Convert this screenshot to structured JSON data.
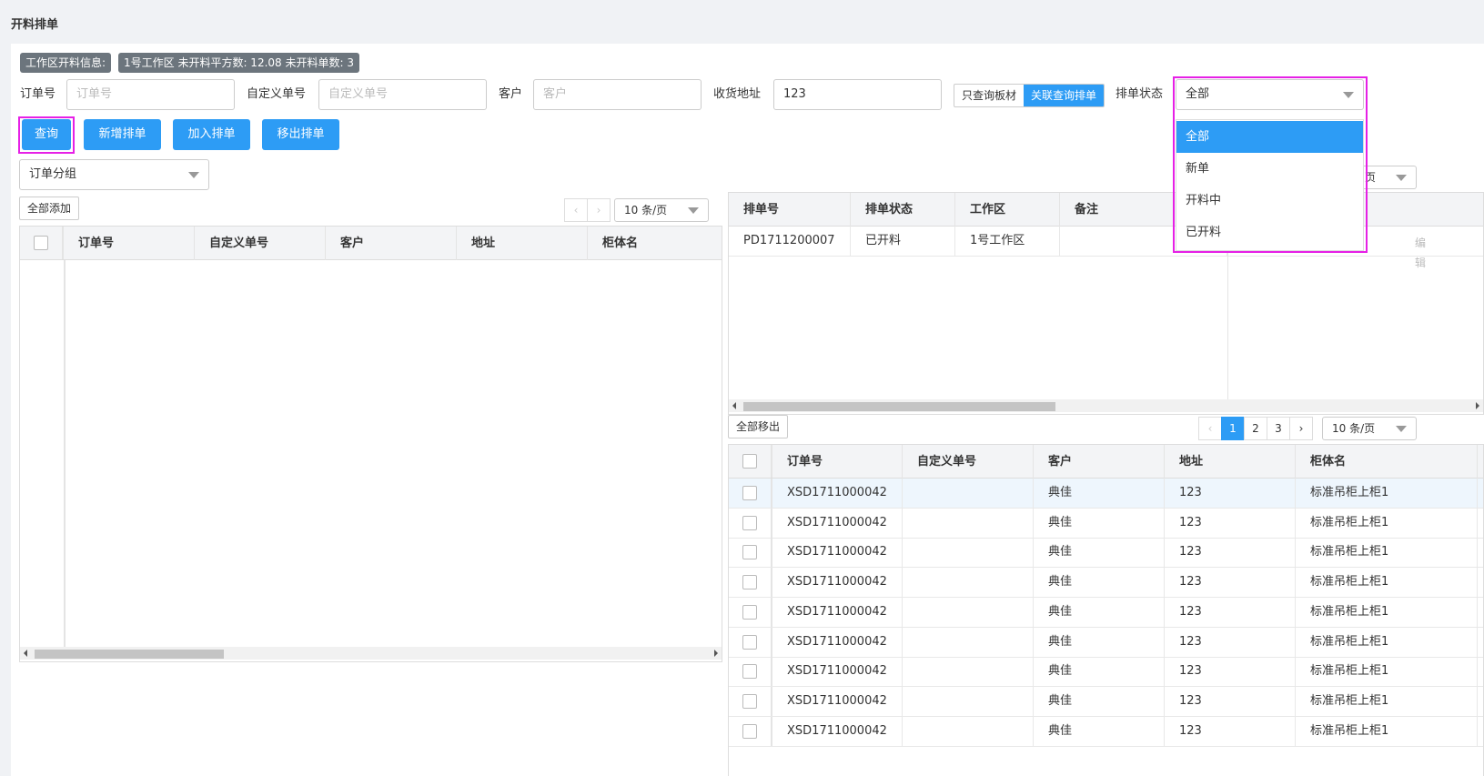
{
  "page": {
    "title": "开料排单"
  },
  "info": {
    "tag1": "工作区开料信息:",
    "tag2": "1号工作区 未开料平方数: 12.08 未开料单数: 3"
  },
  "filters": {
    "order_no_label": "订单号",
    "order_no_placeholder": "订单号",
    "custom_no_label": "自定义单号",
    "custom_no_placeholder": "自定义单号",
    "customer_label": "客户",
    "customer_placeholder": "客户",
    "address_label": "收货地址",
    "address_value": "123",
    "toggle_board_only": "只查询板材",
    "toggle_linked": "关联查询排单",
    "status_label": "排单状态",
    "status_value": "全部",
    "status_options": [
      "全部",
      "新单",
      "开料中",
      "已开料"
    ]
  },
  "buttons": {
    "query": "查询",
    "new_schedule": "新增排单",
    "add_schedule": "加入排单",
    "remove_schedule": "移出排单"
  },
  "left": {
    "group_select": "订单分组",
    "add_all": "全部添加",
    "page_size": "10 条/页",
    "columns": [
      "订单号",
      "自定义单号",
      "客户",
      "地址",
      "柜体名"
    ]
  },
  "schedule": {
    "columns": [
      "排单号",
      "排单状态",
      "工作区",
      "备注"
    ],
    "rows": [
      {
        "no": "PD1711200007",
        "status": "已开料",
        "area": "1号工作区",
        "remark": ""
      }
    ],
    "behind_page_size_suffix": "页",
    "behind_edit": "编辑"
  },
  "bottom": {
    "remove_all": "全部移出",
    "pages": [
      "1",
      "2",
      "3"
    ],
    "current_page": "1",
    "page_size": "10 条/页",
    "columns": [
      "订单号",
      "自定义单号",
      "客户",
      "地址",
      "柜体名"
    ],
    "rows": [
      {
        "order": "XSD1711000042",
        "custom": "",
        "customer": "典佳",
        "address": "123",
        "cabinet": "标准吊柜上柜1"
      },
      {
        "order": "XSD1711000042",
        "custom": "",
        "customer": "典佳",
        "address": "123",
        "cabinet": "标准吊柜上柜1"
      },
      {
        "order": "XSD1711000042",
        "custom": "",
        "customer": "典佳",
        "address": "123",
        "cabinet": "标准吊柜上柜1"
      },
      {
        "order": "XSD1711000042",
        "custom": "",
        "customer": "典佳",
        "address": "123",
        "cabinet": "标准吊柜上柜1"
      },
      {
        "order": "XSD1711000042",
        "custom": "",
        "customer": "典佳",
        "address": "123",
        "cabinet": "标准吊柜上柜1"
      },
      {
        "order": "XSD1711000042",
        "custom": "",
        "customer": "典佳",
        "address": "123",
        "cabinet": "标准吊柜上柜1"
      },
      {
        "order": "XSD1711000042",
        "custom": "",
        "customer": "典佳",
        "address": "123",
        "cabinet": "标准吊柜上柜1"
      },
      {
        "order": "XSD1711000042",
        "custom": "",
        "customer": "典佳",
        "address": "123",
        "cabinet": "标准吊柜上柜1"
      },
      {
        "order": "XSD1711000042",
        "custom": "",
        "customer": "典佳",
        "address": "123",
        "cabinet": "标准吊柜上柜1"
      }
    ]
  },
  "colors": {
    "primary": "#2d9cf5",
    "highlight": "#e620e6",
    "tag": "#6c757d"
  }
}
